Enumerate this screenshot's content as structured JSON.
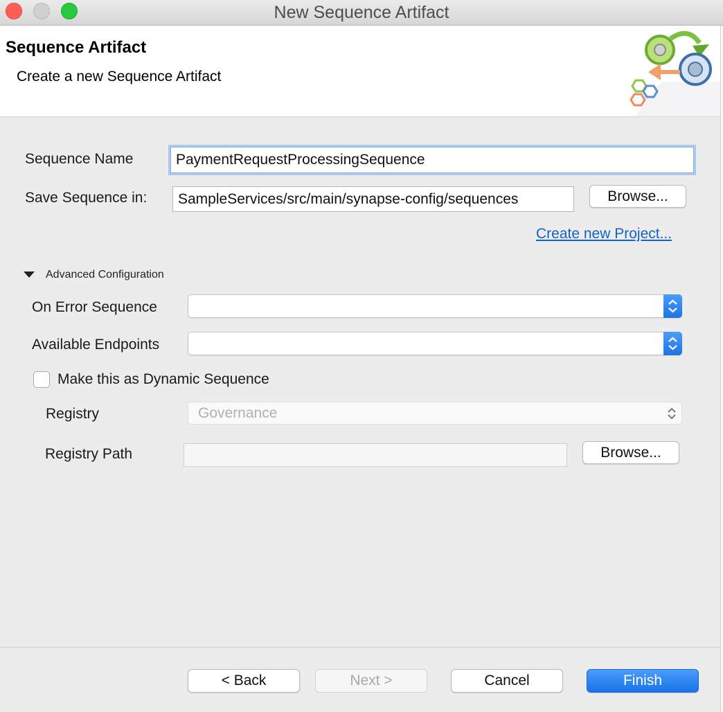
{
  "window": {
    "title": "New Sequence Artifact"
  },
  "header": {
    "title": "Sequence Artifact",
    "subtitle": "Create a new Sequence Artifact",
    "logo_icon": "sequence-wizard-icon"
  },
  "form": {
    "sequence_name_label": "Sequence Name",
    "sequence_name_value": "PaymentRequestProcessingSequence",
    "save_in_label": "Save Sequence in:",
    "save_in_value": "SampleServices/src/main/synapse-config/sequences",
    "browse_label": "Browse...",
    "create_project_link": "Create new Project..."
  },
  "advanced": {
    "section_label": "Advanced Configuration",
    "expanded_icon": "disclosure-triangle-down-icon",
    "on_error_label": "On Error Sequence",
    "on_error_value": "",
    "endpoints_label": "Available Endpoints",
    "endpoints_value": "",
    "dynamic_checkbox_label": "Make this as Dynamic Sequence",
    "dynamic_checked": false,
    "registry_label": "Registry",
    "registry_value": "Governance",
    "registry_path_label": "Registry Path",
    "registry_path_value": "",
    "registry_browse_label": "Browse..."
  },
  "footer": {
    "back_label": "< Back",
    "next_label": "Next >",
    "cancel_label": "Cancel",
    "finish_label": "Finish"
  },
  "colors": {
    "accent": "#1a73e8",
    "link": "#1463c8",
    "close": "#ff5f57",
    "maximize": "#28c840"
  }
}
